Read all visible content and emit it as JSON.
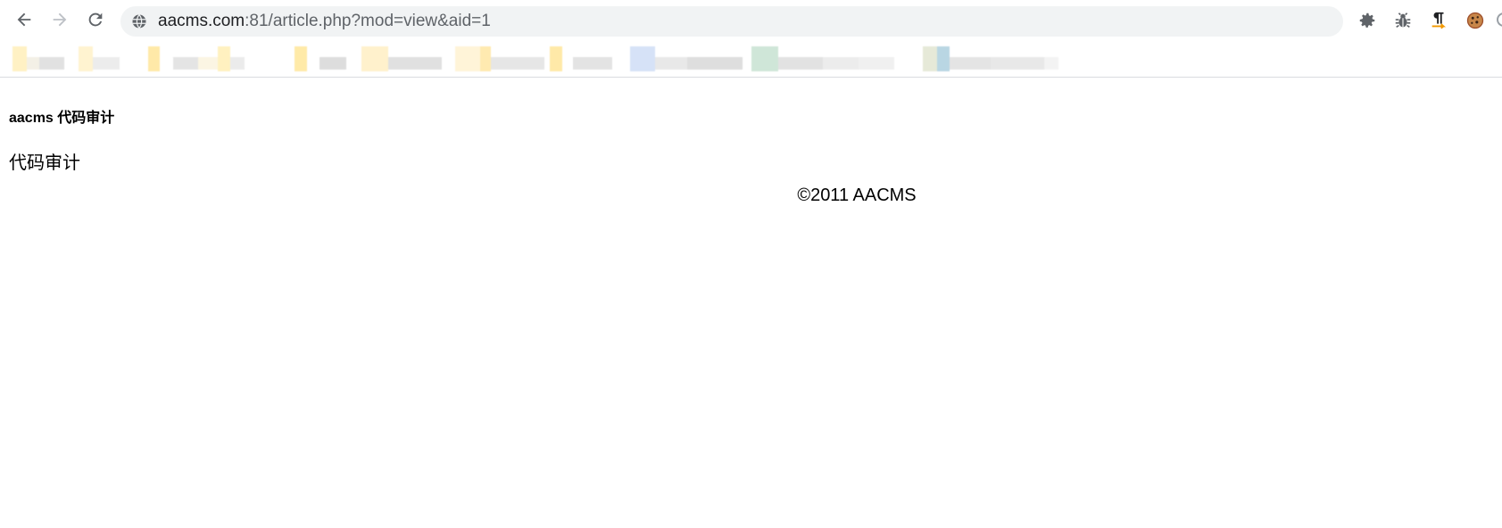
{
  "browser": {
    "address_bar": {
      "host": "aacms.com",
      "rest": ":81/article.php?mod=view&aid=1"
    },
    "icons": {
      "back": "arrow-left-icon",
      "forward": "arrow-right-icon",
      "reload": "reload-icon",
      "site_info": "globe-icon",
      "extensions": [
        "gear-extension-icon",
        "bug-extension-icon",
        "paragraph-extension-icon",
        "cookie-extension-icon"
      ]
    },
    "bookmarks_bar": {
      "note": "",
      "blurred": true
    }
  },
  "page": {
    "site_title": "aacms 代码审计",
    "article_body": "代码审计",
    "footer": "©2011 AACMS"
  },
  "colors": {
    "omnibox_bg": "#f1f3f4",
    "toolbar_icon": "#5f6368",
    "text": "#000000"
  }
}
